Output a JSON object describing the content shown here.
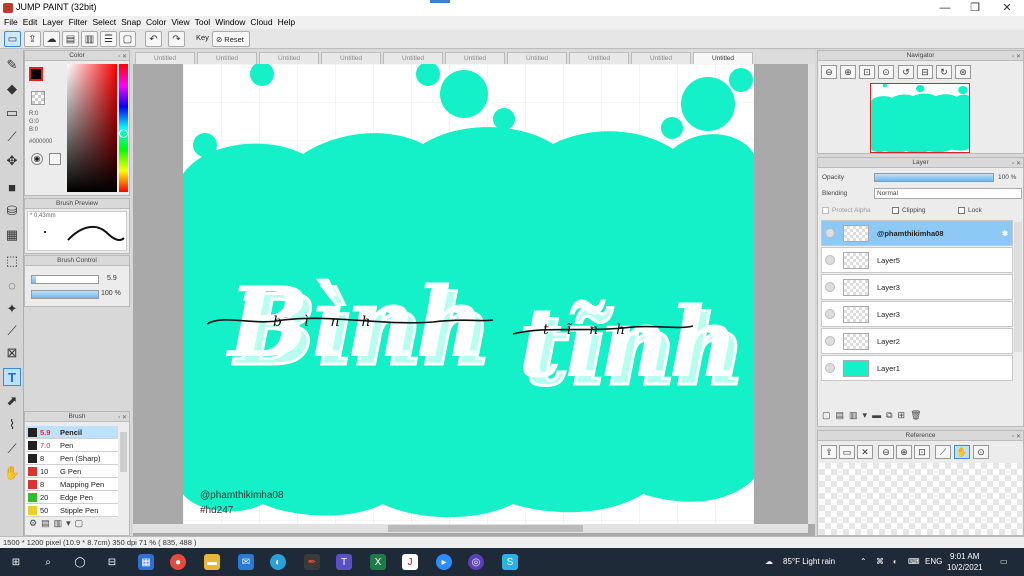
{
  "window": {
    "title": "JUMP PAINT (32bit)",
    "minimize_glyph": "—",
    "restore_glyph": "❐",
    "close_glyph": "✕"
  },
  "menu": [
    "File",
    "Edit",
    "Layer",
    "Filter",
    "Select",
    "Snap",
    "Color",
    "View",
    "Tool",
    "Window",
    "Cloud",
    "Help"
  ],
  "toolbar": {
    "key_label": "Key",
    "reset_label": "Reset",
    "icons": [
      "selection-icon",
      "export-icon",
      "cloud-icon",
      "save-icon",
      "save-as-icon",
      "list-icon",
      "window-icon"
    ]
  },
  "panels": {
    "color": {
      "title": "Color",
      "r": "R:0",
      "g": "G:0",
      "b": "B:0",
      "hex": "#000000",
      "fg_color": "#000000"
    },
    "brush_preview": {
      "title": "Brush Preview",
      "size": "* 0.43mm"
    },
    "brush_control": {
      "title": "Brush Control",
      "size_value": "5.9",
      "opacity_value": "100 %",
      "size_level": 0.06,
      "opacity_level": 1.0
    },
    "brush": {
      "title": "Brush",
      "items": [
        {
          "size": "5.9",
          "name": "Pencil",
          "color": "#222222",
          "selected": true
        },
        {
          "size": "7.0",
          "name": "Pen",
          "color": "#222222",
          "selected": false
        },
        {
          "size": "8",
          "name": "Pen (Sharp)",
          "color": "#222222",
          "selected": false
        },
        {
          "size": "10",
          "name": "G Pen",
          "color": "#dd3333",
          "selected": false
        },
        {
          "size": "8",
          "name": "Mapping Pen",
          "color": "#dd3333",
          "selected": false
        },
        {
          "size": "20",
          "name": "Edge Pen",
          "color": "#33bb33",
          "selected": false
        },
        {
          "size": "50",
          "name": "Stipple Pen",
          "color": "#e8d22a",
          "selected": false
        }
      ]
    },
    "navigator": {
      "title": "Navigator"
    },
    "layer": {
      "title": "Layer",
      "opacity_label": "Opacity",
      "opacity_value": "100 %",
      "blending_label": "Blending",
      "blending_value": "Normal",
      "protect_alpha": "Protect Alpha",
      "clipping": "Clipping",
      "lock": "Lock",
      "items": [
        {
          "name": "@phamthikimha08",
          "selected": true,
          "thumb": "text"
        },
        {
          "name": "Layer5",
          "selected": false,
          "thumb": "checker"
        },
        {
          "name": "Layer3",
          "selected": false,
          "thumb": "checker"
        },
        {
          "name": "Layer3",
          "selected": false,
          "thumb": "checker"
        },
        {
          "name": "Layer2",
          "selected": false,
          "thumb": "checker"
        },
        {
          "name": "Layer1",
          "selected": false,
          "thumb": "mint"
        }
      ]
    },
    "reference": {
      "title": "Reference"
    }
  },
  "tabs": [
    "Untitled",
    "Untitled",
    "Untitled",
    "Untitled",
    "Untitled",
    "Untitled",
    "Untitled",
    "Untitled",
    "Untitled",
    "Untitled"
  ],
  "artwork": {
    "main_text_1": "Bình",
    "main_text_2": "tĩnh",
    "script_1": "bình",
    "script_2": "tĩnh",
    "credit": "@phamthikimha08",
    "hashtag": "#hd247",
    "accent_color": "#14f0c8"
  },
  "statusbar": {
    "text": "1500 * 1200 pixel   (10.9 * 8.7cm)   350 dpi   71 %   ( 835, 488 )"
  },
  "taskbar": {
    "weather": "85°F  Light rain",
    "lang": "ENG",
    "time": "9:01 AM",
    "date": "10/2/2021"
  }
}
